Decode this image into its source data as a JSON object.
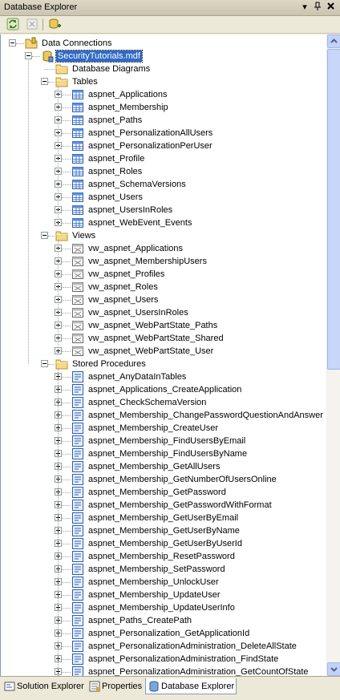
{
  "window": {
    "title": "Database Explorer"
  },
  "titlebar_buttons": [
    {
      "name": "dropdown-icon",
      "glyph": "▾"
    },
    {
      "name": "pin-icon",
      "glyph": "ᛘ"
    },
    {
      "name": "close-icon",
      "glyph": "✕"
    }
  ],
  "toolbar": [
    {
      "name": "refresh-icon"
    },
    {
      "name": "delete-icon"
    },
    {
      "name": "connect-to-database-icon"
    }
  ],
  "tree": {
    "data_connections": "Data Connections",
    "database": "SecurityTutorials.mdf",
    "database_diagrams": "Database Diagrams",
    "tables_label": "Tables",
    "tables": [
      "aspnet_Applications",
      "aspnet_Membership",
      "aspnet_Paths",
      "aspnet_PersonalizationAllUsers",
      "aspnet_PersonalizationPerUser",
      "aspnet_Profile",
      "aspnet_Roles",
      "aspnet_SchemaVersions",
      "aspnet_Users",
      "aspnet_UsersInRoles",
      "aspnet_WebEvent_Events"
    ],
    "views_label": "Views",
    "views": [
      "vw_aspnet_Applications",
      "vw_aspnet_MembershipUsers",
      "vw_aspnet_Profiles",
      "vw_aspnet_Roles",
      "vw_aspnet_Users",
      "vw_aspnet_UsersInRoles",
      "vw_aspnet_WebPartState_Paths",
      "vw_aspnet_WebPartState_Shared",
      "vw_aspnet_WebPartState_User"
    ],
    "procs_label": "Stored Procedures",
    "procs": [
      "aspnet_AnyDataInTables",
      "aspnet_Applications_CreateApplication",
      "aspnet_CheckSchemaVersion",
      "aspnet_Membership_ChangePasswordQuestionAndAnswer",
      "aspnet_Membership_CreateUser",
      "aspnet_Membership_FindUsersByEmail",
      "aspnet_Membership_FindUsersByName",
      "aspnet_Membership_GetAllUsers",
      "aspnet_Membership_GetNumberOfUsersOnline",
      "aspnet_Membership_GetPassword",
      "aspnet_Membership_GetPasswordWithFormat",
      "aspnet_Membership_GetUserByEmail",
      "aspnet_Membership_GetUserByName",
      "aspnet_Membership_GetUserByUserId",
      "aspnet_Membership_ResetPassword",
      "aspnet_Membership_SetPassword",
      "aspnet_Membership_UnlockUser",
      "aspnet_Membership_UpdateUser",
      "aspnet_Membership_UpdateUserInfo",
      "aspnet_Paths_CreatePath",
      "aspnet_Personalization_GetApplicationId",
      "aspnet_PersonalizationAdministration_DeleteAllState",
      "aspnet_PersonalizationAdministration_FindState",
      "aspnet_PersonalizationAdministration_GetCountOfState"
    ]
  },
  "tabs": [
    {
      "label": "Solution Explorer",
      "icon": "solution-explorer-icon"
    },
    {
      "label": "Properties",
      "icon": "properties-icon"
    },
    {
      "label": "Database Explorer",
      "icon": "database-explorer-icon",
      "active": true
    }
  ]
}
